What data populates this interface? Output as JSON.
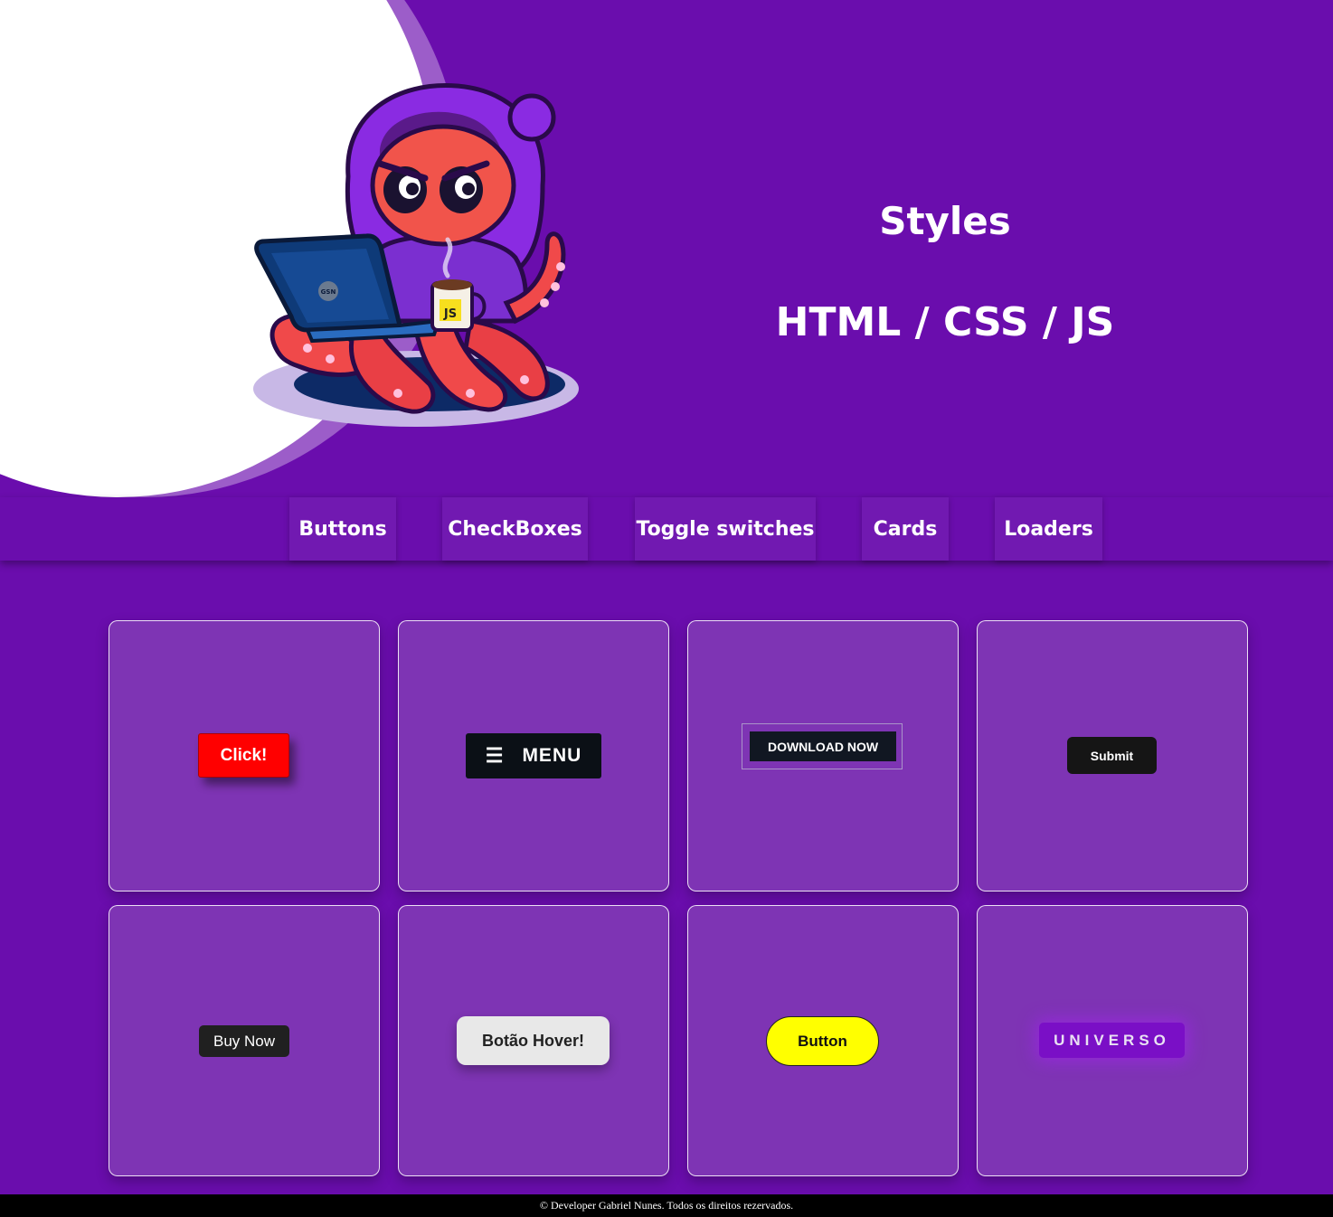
{
  "hero": {
    "title": "Styles",
    "subtitle": "HTML / CSS / JS",
    "mascot": {
      "laptop_text": "GSN",
      "mug_text": "JS"
    }
  },
  "nav": {
    "items": [
      {
        "label": "Buttons"
      },
      {
        "label": "CheckBoxes"
      },
      {
        "label": "Toggle switches"
      },
      {
        "label": "Cards"
      },
      {
        "label": "Loaders"
      }
    ]
  },
  "cards": {
    "click": {
      "label": "Click!"
    },
    "menu": {
      "icon": "menu-icon",
      "label": "MENU"
    },
    "download": {
      "label": "DOWNLOAD NOW"
    },
    "submit": {
      "label": "Submit"
    },
    "buynow": {
      "label": "Buy Now"
    },
    "hover": {
      "label": "Botão Hover!"
    },
    "yellow": {
      "label": "Button"
    },
    "universo": {
      "label": "UNIVERSO"
    }
  },
  "footer": {
    "text": "© Developer Gabriel Nunes. Todos os direitos rezervados."
  },
  "colors": {
    "background": "#6a0dad",
    "card": "#7e34b4",
    "click_button": "#ff0000",
    "yellow_button": "#ffff00",
    "universo_button": "#7a0fc6"
  }
}
